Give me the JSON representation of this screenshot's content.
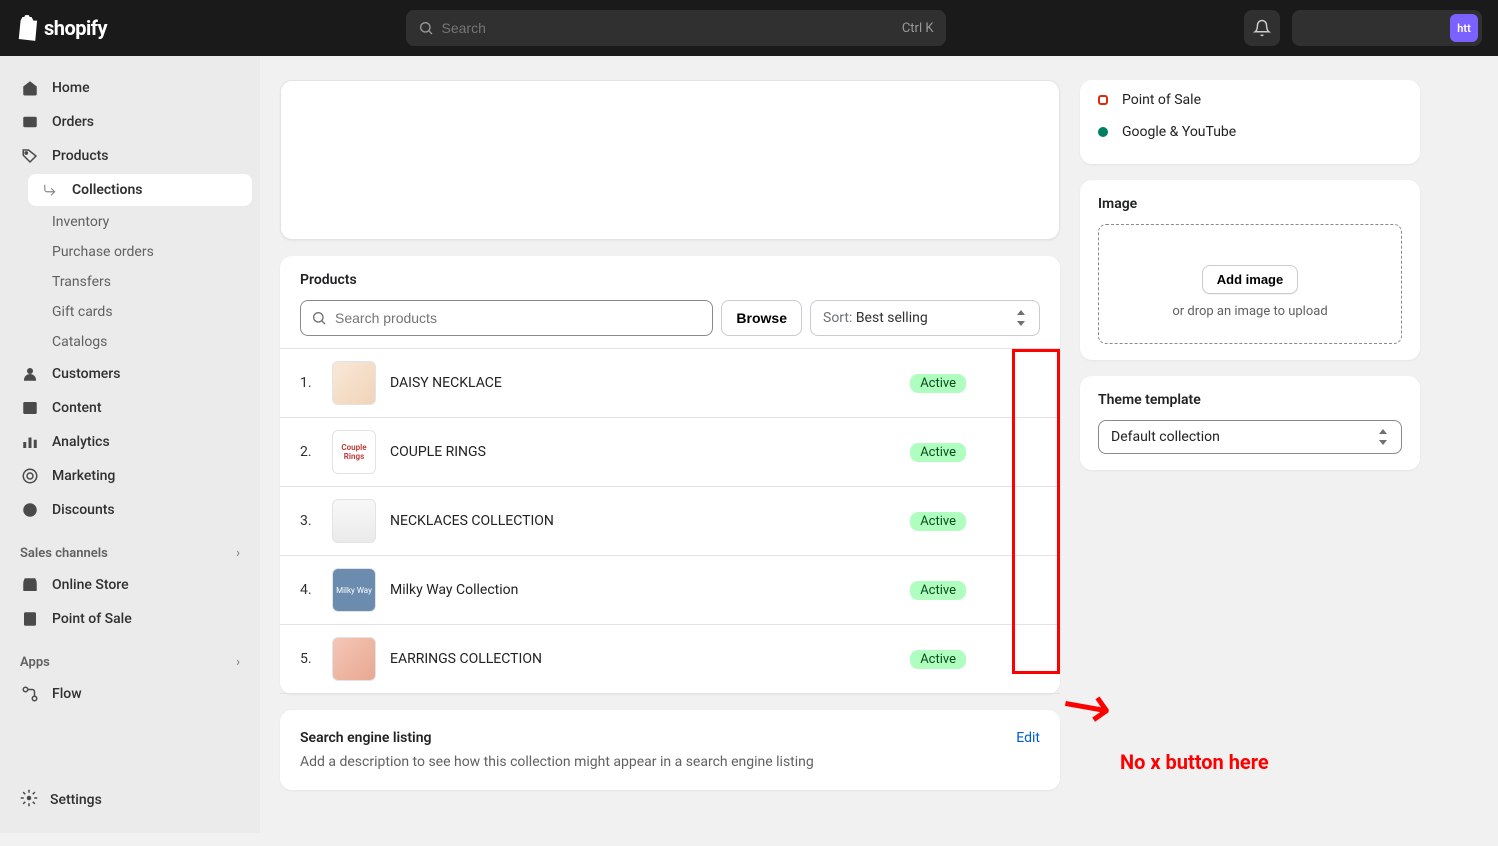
{
  "topbar": {
    "brand": "shopify",
    "search_placeholder": "Search",
    "kbd": "Ctrl K",
    "avatar": "htt"
  },
  "sidebar": {
    "home": "Home",
    "orders": "Orders",
    "products": "Products",
    "products_sub": {
      "collections": "Collections",
      "inventory": "Inventory",
      "purchase_orders": "Purchase orders",
      "transfers": "Transfers",
      "gift_cards": "Gift cards",
      "catalogs": "Catalogs"
    },
    "customers": "Customers",
    "content": "Content",
    "analytics": "Analytics",
    "marketing": "Marketing",
    "discounts": "Discounts",
    "sales_channels": "Sales channels",
    "online_store": "Online Store",
    "point_of_sale": "Point of Sale",
    "apps": "Apps",
    "flow": "Flow",
    "settings": "Settings"
  },
  "products": {
    "title": "Products",
    "search_placeholder": "Search products",
    "browse": "Browse",
    "sort_prefix": "Sort: ",
    "sort_value": "Best selling",
    "rows": [
      {
        "num": "1.",
        "name": "DAISY NECKLACE",
        "status": "Active",
        "thumb_text": ""
      },
      {
        "num": "2.",
        "name": "COUPLE RINGS",
        "status": "Active",
        "thumb_text": "Couple Rings"
      },
      {
        "num": "3.",
        "name": "NECKLACES COLLECTION",
        "status": "Active",
        "thumb_text": ""
      },
      {
        "num": "4.",
        "name": "Milky Way Collection",
        "status": "Active",
        "thumb_text": "Milky Way"
      },
      {
        "num": "5.",
        "name": "EARRINGS COLLECTION",
        "status": "Active",
        "thumb_text": ""
      }
    ]
  },
  "seo": {
    "title": "Search engine listing",
    "edit": "Edit",
    "desc": "Add a description to see how this collection might appear in a search engine listing"
  },
  "channels": {
    "pos": "Point of Sale",
    "google": "Google & YouTube"
  },
  "image": {
    "title": "Image",
    "add": "Add image",
    "drop": "or drop an image to upload"
  },
  "theme": {
    "title": "Theme template",
    "value": "Default collection"
  },
  "annotation": {
    "text": "No x button here"
  }
}
